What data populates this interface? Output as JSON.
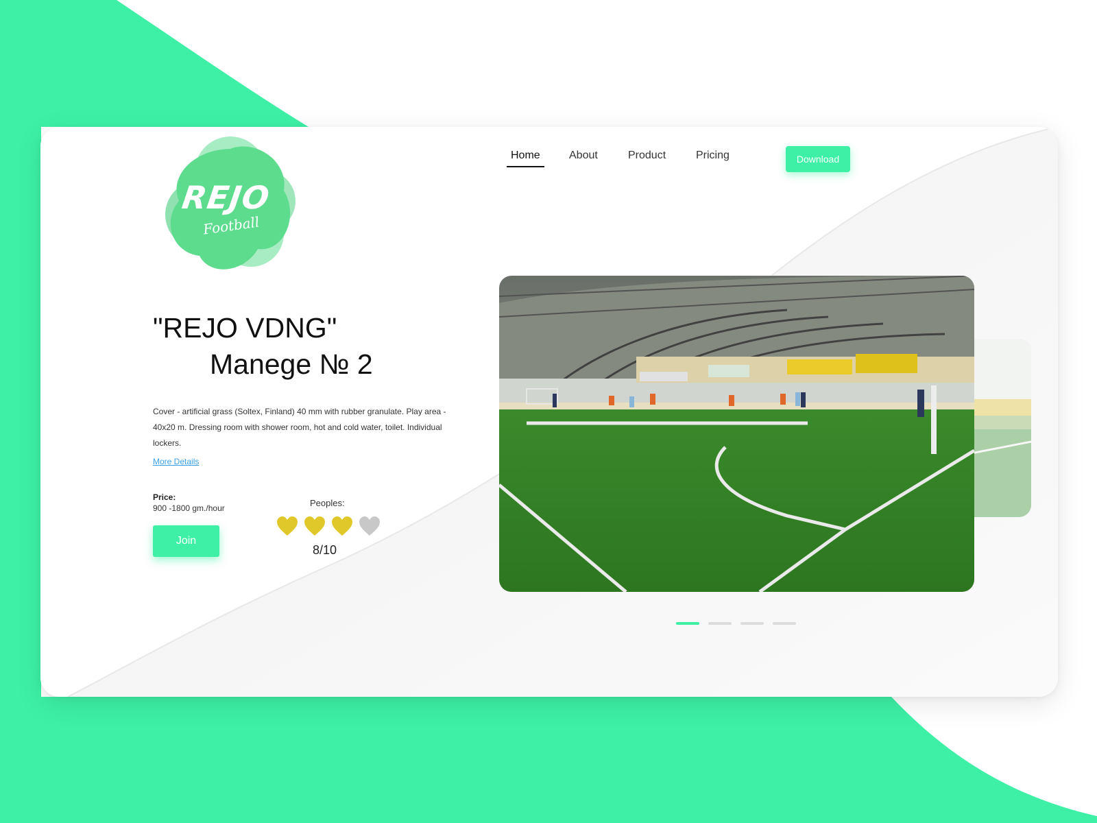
{
  "colors": {
    "accent": "#3df0a5",
    "logo_green": "#5ddc8e",
    "heart_filled": "#e0c82a",
    "heart_empty": "#c8c8c8",
    "link": "#3aa0e8"
  },
  "logo": {
    "title": "REJO",
    "subtitle": "Football"
  },
  "nav": {
    "items": [
      {
        "label": "Home",
        "active": true
      },
      {
        "label": "About",
        "active": false
      },
      {
        "label": "Product",
        "active": false
      },
      {
        "label": "Pricing",
        "active": false
      }
    ],
    "download_label": "Download"
  },
  "venue": {
    "title_line1": "\"REJO VDNG\"",
    "title_line2": "Manege № 2",
    "description": "Cover - artificial grass (Soltex, Finland) 40 mm with rubber granulate. Play area - 40x20 m. Dressing room with shower room, hot and cold water, toilet. Individual lockers.",
    "more_link": "More Details",
    "price_label": "Price:",
    "price_value": "900 -1800 gm./hour",
    "join_label": "Join",
    "peoples_label": "Peoples:",
    "people_count": "8/10",
    "hearts": [
      {
        "icon": "heart-icon",
        "filled": true
      },
      {
        "icon": "heart-icon",
        "filled": true
      },
      {
        "icon": "heart-icon",
        "filled": true
      },
      {
        "icon": "heart-icon",
        "filled": false
      }
    ]
  },
  "carousel": {
    "slides": 4,
    "active_index": 0
  }
}
